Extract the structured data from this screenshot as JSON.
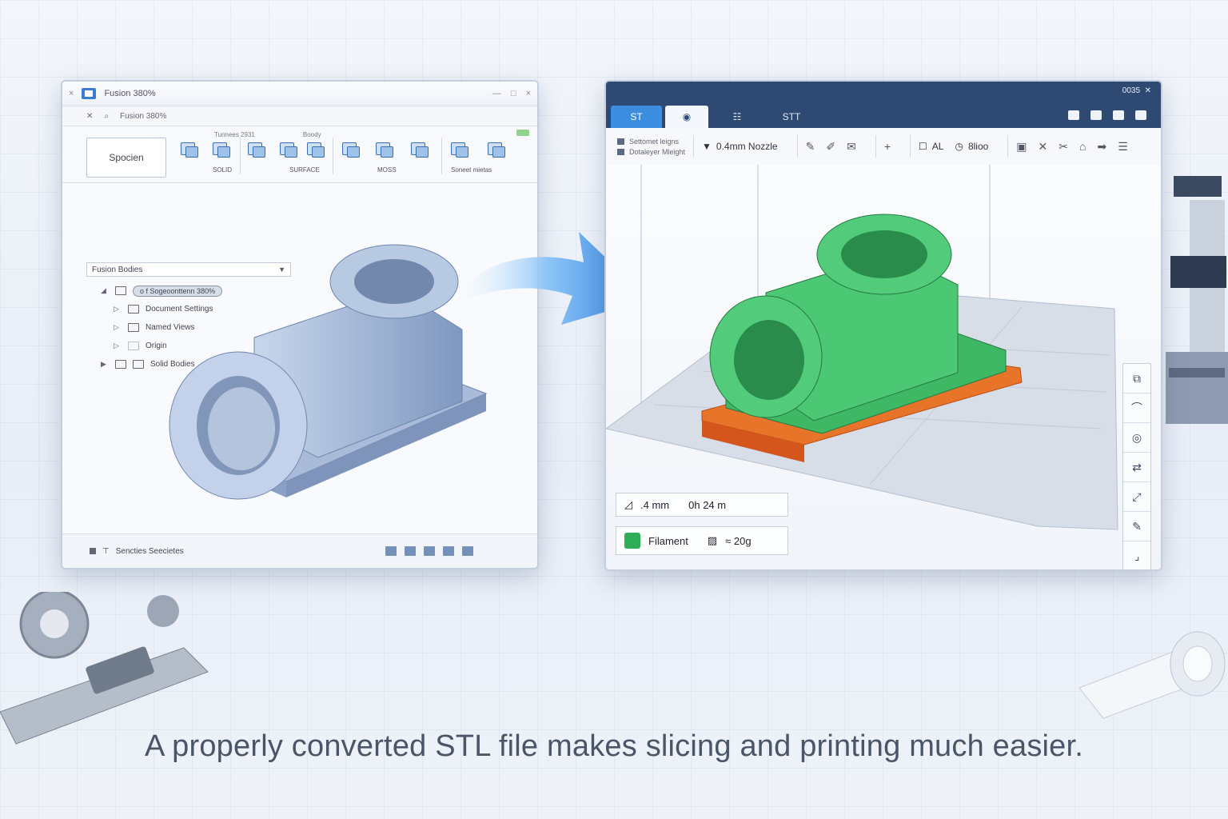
{
  "cad_window": {
    "title": "Fusion 380%",
    "tab_title": "Fusion 380%",
    "ribbon": {
      "top_labels": [
        "Tunnees 2931",
        "Boody"
      ],
      "select_label": "Spocien",
      "group_labels": [
        "SOLID",
        "SURFACE",
        "MOSS",
        "Soneet mietas"
      ]
    },
    "browser_dropdown": "Fusion Bodies",
    "tree": {
      "root": "o f Sogeoonttenn 380%",
      "items": [
        "Document Settings",
        "Named Views",
        "Origin",
        "Solid Bodies"
      ]
    },
    "footer_label": "Sencties Seecietes"
  },
  "slicer_window": {
    "top_readout": "0035",
    "tabs": [
      "ST",
      "STT"
    ],
    "toolbar": {
      "layer_height": "Settomet leigns",
      "layer_height_sub": "Dotaleyer Mleight",
      "nozzle": "0.4mm Nozzle",
      "al_label": "AL",
      "slice_label": "8lioo"
    },
    "info": {
      "layer": ".4 mm",
      "time": "0h 24 m",
      "filament_label": "Filament",
      "filament_amount": "≈ 20g"
    },
    "side_tools": [
      "copy-icon",
      "arc-icon",
      "view-icon",
      "move-icon",
      "scale-icon",
      "paint-icon",
      "support-icon"
    ]
  },
  "caption": "A properly converted STL file makes slicing and printing much easier.",
  "colors": {
    "accent": "#3b8de0",
    "slicer_header": "#2f4a72",
    "model_green": "#3fb866",
    "model_blue": "#8fa9cf",
    "raft_orange": "#e8742a"
  }
}
